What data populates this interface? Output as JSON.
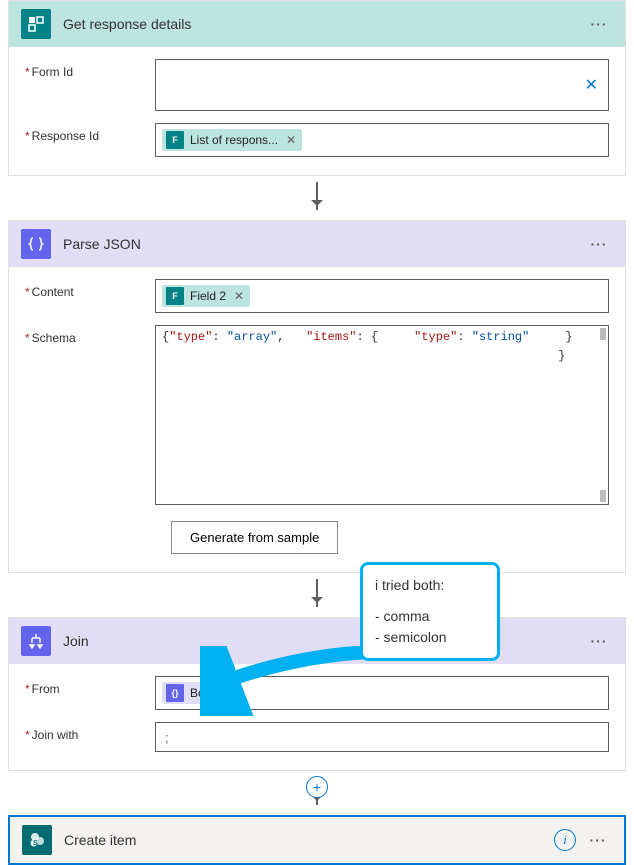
{
  "cards": {
    "getResponse": {
      "title": "Get response details",
      "fields": {
        "formId": {
          "label": "Form Id",
          "token": null
        },
        "responseId": {
          "label": "Response Id",
          "token": "List of respons..."
        }
      }
    },
    "parseJson": {
      "title": "Parse JSON",
      "fields": {
        "content": {
          "label": "Content",
          "token": "Field 2"
        },
        "schema": {
          "label": "Schema",
          "lines": {
            "l0": "{",
            "l1": "    \"type\": \"array\",",
            "l2": "    \"items\": {",
            "l3": "        \"type\": \"string\"",
            "l4": "    }",
            "l5": "}"
          }
        }
      },
      "button": "Generate from sample"
    },
    "join": {
      "title": "Join",
      "fields": {
        "from": {
          "label": "From",
          "token": "Body"
        },
        "joinWith": {
          "label": "Join with",
          "value": ";"
        }
      }
    },
    "createItem": {
      "title": "Create item"
    }
  },
  "callout": {
    "line1": "i tried both:",
    "line2": "- comma",
    "line3": "- semicolon"
  }
}
